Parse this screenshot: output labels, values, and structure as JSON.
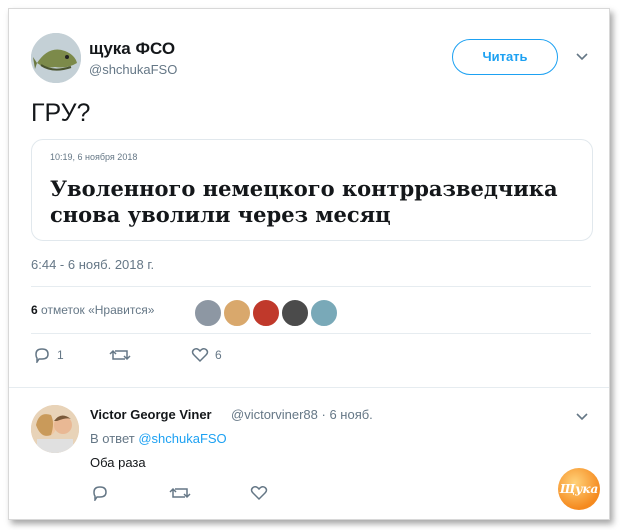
{
  "tweet": {
    "author_name": "щука ФСО",
    "author_handle": "@shchukaFSO",
    "follow_label": "Читать",
    "text": "ГРУ?",
    "card": {
      "date": "10:19, 6 ноября 2018",
      "headline": "Уволенного немецкого контрразведчика снова уволили через месяц"
    },
    "timestamp": "6:44 - 6 нояб. 2018 г.",
    "likes_count": "6",
    "likes_label": "отметок «Нравится»",
    "reply_count": "1",
    "like_count": "6"
  },
  "reply": {
    "author_name": "Victor George Viner",
    "author_handle": "@victorviner88 · 6 нояб.",
    "in_reply_prefix": "В ответ",
    "in_reply_handle": "@shchukaFSO",
    "text": "Оба раза"
  },
  "watermark": "Щука",
  "colors": {
    "accent": "#1da1f2",
    "muted": "#657786"
  }
}
